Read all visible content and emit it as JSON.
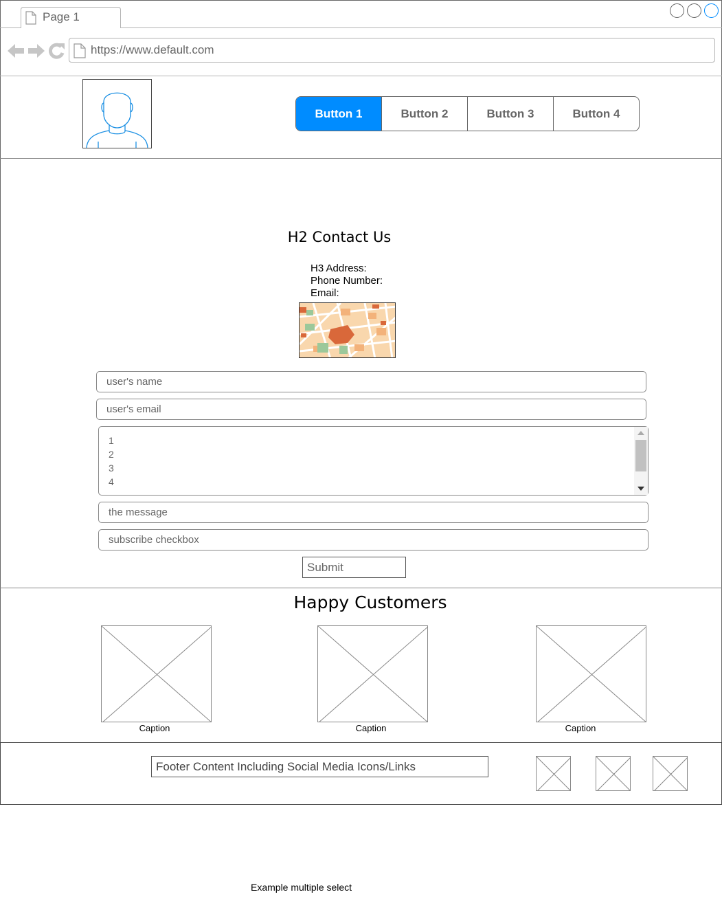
{
  "browser": {
    "tab_title": "Page 1",
    "url": "https://www.default.com",
    "icons": [
      "back-arrow-icon",
      "forward-arrow-icon",
      "reload-icon",
      "page-icon",
      "window-control-icon"
    ]
  },
  "header": {
    "nav_buttons": [
      "Button 1",
      "Button 2",
      "Button 3",
      "Button 4"
    ],
    "active_button": "Button 1",
    "accent_color": "#008cff"
  },
  "contact": {
    "heading": "H2 Contact Us",
    "address_label": "H3 Address:",
    "phone_label": "Phone Number:",
    "email_label": "Email:",
    "name_placeholder": "user's name",
    "email_placeholder": "user's email",
    "list_items": [
      "1",
      "2",
      "3",
      "4"
    ],
    "message_placeholder": "the message",
    "subscribe_label": "subscribe checkbox",
    "submit_label": "Submit"
  },
  "customers": {
    "heading": "Happy Customers",
    "captions": [
      "Caption",
      "Caption",
      "Caption"
    ]
  },
  "footer": {
    "text": "Footer Content Including Social Media Icons/Links"
  },
  "note": "Example multiple select"
}
